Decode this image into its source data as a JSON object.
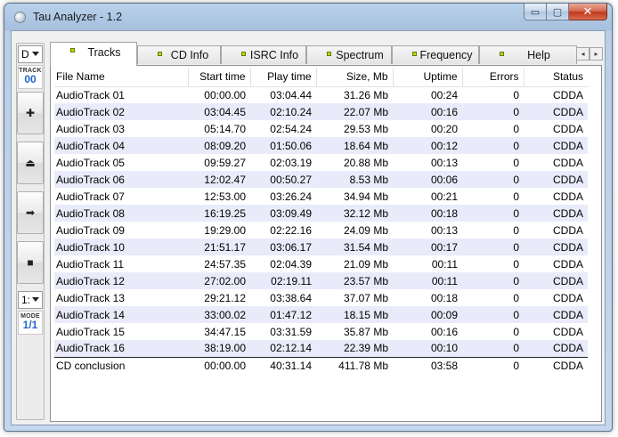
{
  "window": {
    "title": "Tau Analyzer - 1.2",
    "buttons": {
      "minimize": "▭",
      "maximize": "▢",
      "close": "✕"
    }
  },
  "toolbar": {
    "drive_value": "D",
    "track_label": "TRACK",
    "track_value": "00",
    "buttons": [
      {
        "name": "add-button",
        "icon": "plus-icon",
        "glyph": "✚"
      },
      {
        "name": "eject-button",
        "icon": "eject-icon",
        "glyph": "⏏"
      },
      {
        "name": "next-button",
        "icon": "arrow-right-icon",
        "glyph": "➡"
      },
      {
        "name": "stop-button",
        "icon": "stop-icon",
        "glyph": "■"
      }
    ],
    "speed_value": "1:",
    "mode_label": "MODE",
    "mode_value": "1/1"
  },
  "tabs": [
    {
      "label": "Tracks",
      "active": true
    },
    {
      "label": "CD Info",
      "active": false
    },
    {
      "label": "ISRC Info",
      "active": false
    },
    {
      "label": "Spectrum",
      "active": false
    },
    {
      "label": "Frequency",
      "active": false
    },
    {
      "label": "Help",
      "active": false
    }
  ],
  "tab_scroll": {
    "left": "◂",
    "right": "▸"
  },
  "table": {
    "columns": [
      "File Name",
      "Start time",
      "Play time",
      "Size, Mb",
      "Uptime",
      "Errors",
      "Status"
    ],
    "rows": [
      [
        "AudioTrack 01",
        "00:00.00",
        "03:04.44",
        "31.26 Mb",
        "00:24",
        "0",
        "CDDA"
      ],
      [
        "AudioTrack 02",
        "03:04.45",
        "02:10.24",
        "22.07 Mb",
        "00:16",
        "0",
        "CDDA"
      ],
      [
        "AudioTrack 03",
        "05:14.70",
        "02:54.24",
        "29.53 Mb",
        "00:20",
        "0",
        "CDDA"
      ],
      [
        "AudioTrack 04",
        "08:09.20",
        "01:50.06",
        "18.64 Mb",
        "00:12",
        "0",
        "CDDA"
      ],
      [
        "AudioTrack 05",
        "09:59.27",
        "02:03.19",
        "20.88 Mb",
        "00:13",
        "0",
        "CDDA"
      ],
      [
        "AudioTrack 06",
        "12:02.47",
        "00:50.27",
        "8.53 Mb",
        "00:06",
        "0",
        "CDDA"
      ],
      [
        "AudioTrack 07",
        "12:53.00",
        "03:26.24",
        "34.94 Mb",
        "00:21",
        "0",
        "CDDA"
      ],
      [
        "AudioTrack 08",
        "16:19.25",
        "03:09.49",
        "32.12 Mb",
        "00:18",
        "0",
        "CDDA"
      ],
      [
        "AudioTrack 09",
        "19:29.00",
        "02:22.16",
        "24.09 Mb",
        "00:13",
        "0",
        "CDDA"
      ],
      [
        "AudioTrack 10",
        "21:51.17",
        "03:06.17",
        "31.54 Mb",
        "00:17",
        "0",
        "CDDA"
      ],
      [
        "AudioTrack 11",
        "24:57.35",
        "02:04.39",
        "21.09 Mb",
        "00:11",
        "0",
        "CDDA"
      ],
      [
        "AudioTrack 12",
        "27:02.00",
        "02:19.11",
        "23.57 Mb",
        "00:11",
        "0",
        "CDDA"
      ],
      [
        "AudioTrack 13",
        "29:21.12",
        "03:38.64",
        "37.07 Mb",
        "00:18",
        "0",
        "CDDA"
      ],
      [
        "AudioTrack 14",
        "33:00.02",
        "01:47.12",
        "18.15 Mb",
        "00:09",
        "0",
        "CDDA"
      ],
      [
        "AudioTrack 15",
        "34:47.15",
        "03:31.59",
        "35.87 Mb",
        "00:16",
        "0",
        "CDDA"
      ],
      [
        "AudioTrack 16",
        "38:19.00",
        "02:12.14",
        "22.39 Mb",
        "00:10",
        "0",
        "CDDA"
      ]
    ],
    "summary": [
      "CD conclusion",
      "00:00.00",
      "40:31.14",
      "411.78 Mb",
      "03:58",
      "0",
      "CDDA"
    ]
  },
  "colors": {
    "alt_row": "#e9ebfa",
    "counter_text": "#1f66c9",
    "tab_led": "#b7e000"
  }
}
